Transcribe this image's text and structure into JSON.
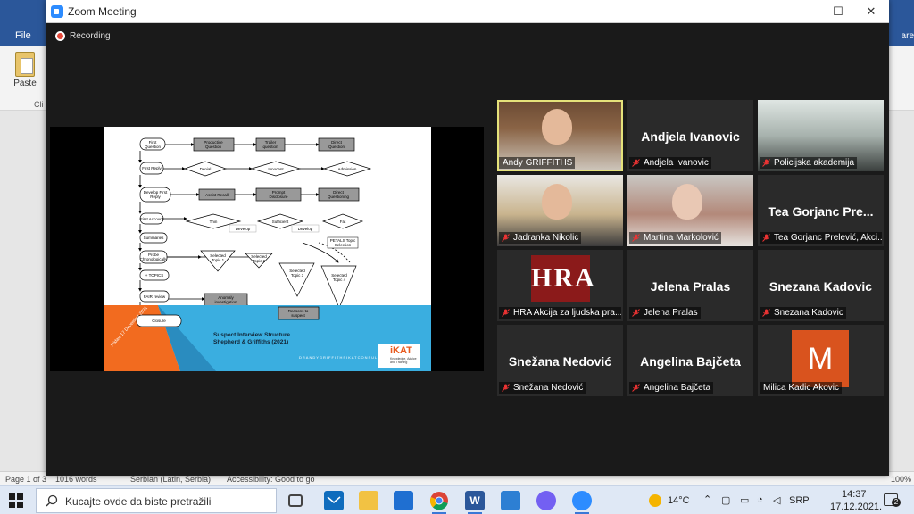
{
  "word": {
    "file_tab": "File",
    "share_tab": "are",
    "paste_label": "Paste",
    "clipboard_group": "Cli",
    "status": {
      "page": "Page 1 of 3",
      "words": "1016 words",
      "language": "Serbian (Latin, Serbia)",
      "accessibility": "Accessibility: Good to go",
      "zoom": "100%"
    }
  },
  "zoom": {
    "window_title": "Zoom Meeting",
    "recording_label": "Recording",
    "colors": {
      "accent": "#2d8cff",
      "recording": "#e64a3b",
      "active_speaker": "#e5e27a"
    },
    "participants": [
      {
        "name": "Andy GRIFFITHS",
        "display": "",
        "video": "man-bookshelf",
        "muted": false,
        "active": true
      },
      {
        "name": "Andjela Ivanovic",
        "display": "Andjela Ivanovic",
        "video": "",
        "muted": true
      },
      {
        "name": "Policijska akademija",
        "display": "",
        "video": "classroom",
        "muted": true
      },
      {
        "name": "Jadranka Nikolic",
        "display": "",
        "video": "woman-blonde",
        "muted": true
      },
      {
        "name": "Martina Markolović",
        "display": "",
        "video": "woman-redhair",
        "muted": true
      },
      {
        "name": "Tea Gorjanc Prelević, Akci...",
        "display": "Tea Gorjanc Pre...",
        "video": "",
        "muted": true
      },
      {
        "name": "HRA Akcija za ljudska pra...",
        "display": "",
        "video": "hra-logo",
        "muted": true
      },
      {
        "name": "Jelena Pralas",
        "display": "Jelena Pralas",
        "video": "",
        "muted": true
      },
      {
        "name": "Snezana Kadovic",
        "display": "Snezana Kadovic",
        "video": "",
        "muted": true
      },
      {
        "name": "Snežana Nedović",
        "display": "Snežana Nedović",
        "video": "",
        "muted": true
      },
      {
        "name": "Angelina Bajčeta",
        "display": "Angelina Bajčeta",
        "video": "",
        "muted": true
      },
      {
        "name": "Milica Kadic Akovic",
        "display": "",
        "avatar_letter": "M",
        "avatar_color": "#d9531e",
        "muted": false
      }
    ]
  },
  "slide": {
    "flow_boxes": [
      "First Question",
      "Productive Question",
      "Trailer question",
      "Direct Question",
      "First Reply",
      "Denial",
      "Innocent",
      "Admission",
      "Develop First Reply",
      "Assist Recall",
      "Prompt Disclosure",
      "Direct Questioning",
      "First Account",
      "Thin",
      "Sufficient",
      "Fat",
      "Develop",
      "Develop",
      "Summaries",
      "PETALS Topic Selection",
      "Probe Chronologically",
      "Selected Topic 1",
      "Selected Topic 2",
      "Selected Topic 3",
      "Selected Topic 4",
      "+ TOPICS",
      "FAIR review",
      "Anomaly investigation",
      "Closure",
      "Reasons to suspect"
    ],
    "footer_title": "Suspect Interview Structure",
    "footer_subtitle": "Shepherd & Griffiths (2021)",
    "date_text": "Friday, 17 December 2021",
    "website": "DRANDYGRIFFITHSIKATCONSULTING.COM",
    "logo_text": "iKAT",
    "logo_tagline_1": "Knowledge, Advice",
    "logo_tagline_2": "and Training"
  },
  "taskbar": {
    "search_placeholder": "Kucajte ovde da biste pretražili",
    "weather": "14°C",
    "language": "SRP",
    "time": "14:37",
    "date": "17.12.2021.",
    "notifications": "2",
    "apps": [
      "task-view",
      "mail",
      "file-explorer",
      "store",
      "chrome",
      "word",
      "photos",
      "viber",
      "zoom"
    ]
  }
}
